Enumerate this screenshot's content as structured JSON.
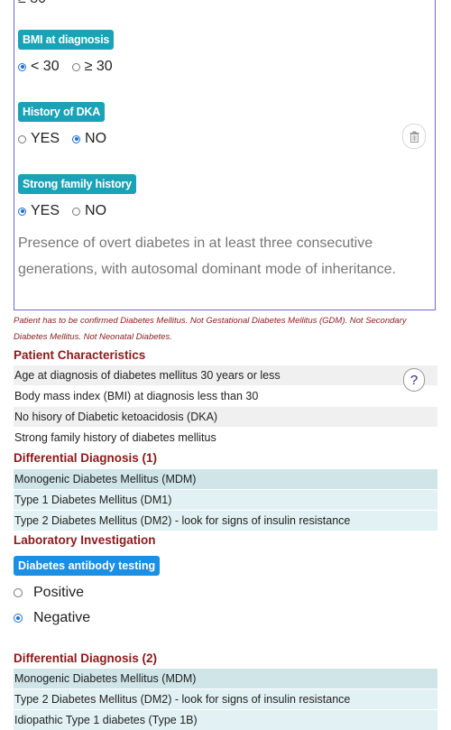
{
  "form": {
    "top_cut_text": "≥ 30",
    "bmi": {
      "label": "BMI at diagnosis",
      "options": [
        "< 30",
        "≥ 30"
      ],
      "selected": 0
    },
    "dka": {
      "label": "History of DKA",
      "options": [
        "YES",
        "NO"
      ],
      "selected": 1
    },
    "family": {
      "label": "Strong family history",
      "options": [
        "YES",
        "NO"
      ],
      "selected": 0
    },
    "family_note": "Presence of overt diabetes in at least three consecutive generations, with autosomal dominant mode of inheritance.",
    "trash_icon": "trash-icon"
  },
  "disclaimer": "Patient has to be confirmed Diabetes Mellitus. Not Gestational Diabetes Mellitus (GDM). Not Secondary Diabetes Mellitus. Not Neonatal Diabetes.",
  "patient_characteristics": {
    "title": "Patient Characteristics",
    "rows": [
      "Age at diagnosis of diabetes mellitus 30 years or less",
      "Body mass index (BMI) at diagnosis less than 30",
      "No hisory of Diabetic ketoacidosis (DKA)",
      "Strong family history of diabetes mellitus"
    ],
    "help_label": "?"
  },
  "differential_1": {
    "title": "Differential Diagnosis (1)",
    "rows": [
      "Monogenic Diabetes Mellitus (MDM)",
      "Type 1 Diabetes Mellitus (DM1)",
      "Type 2 Diabetes Mellitus (DM2) - look for signs of insulin resistance"
    ]
  },
  "lab": {
    "title": "Laboratory Investigation",
    "antibody_label": "Diabetes antibody testing",
    "options": [
      "Positive",
      "Negative"
    ],
    "selected": 1
  },
  "differential_2": {
    "title": "Differential Diagnosis (2)",
    "rows": [
      "Monogenic Diabetes Mellitus (MDM)",
      "Type 2 Diabetes Mellitus (DM2) - look for signs of insulin resistance",
      "Idiopathic Type 1 diabetes (Type 1B)"
    ]
  }
}
